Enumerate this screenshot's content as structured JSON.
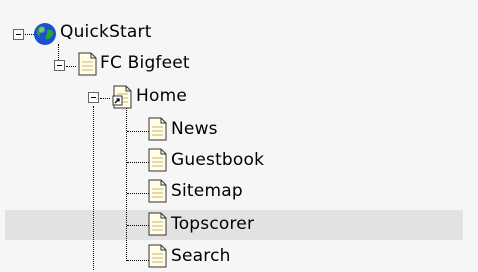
{
  "tree": {
    "root": {
      "label": "QuickStart",
      "icon": "globe-icon",
      "expanded": true
    },
    "site": {
      "label": "FC Bigfeet",
      "icon": "page-icon",
      "expanded": true
    },
    "home": {
      "label": "Home",
      "icon": "shortcut-page-icon",
      "expanded": true
    },
    "pages": [
      {
        "label": "News",
        "icon": "page-icon"
      },
      {
        "label": "Guestbook",
        "icon": "page-icon"
      },
      {
        "label": "Sitemap",
        "icon": "page-icon"
      },
      {
        "label": "Topscorer",
        "icon": "page-icon",
        "selected": true
      },
      {
        "label": "Search",
        "icon": "page-icon"
      }
    ]
  },
  "colors": {
    "background": "#f6f6f6",
    "selected_row": "#e2e2e2",
    "page_icon": "#fffde8",
    "globe_blue": "#1b4fd0",
    "globe_green": "#2ea52a"
  }
}
